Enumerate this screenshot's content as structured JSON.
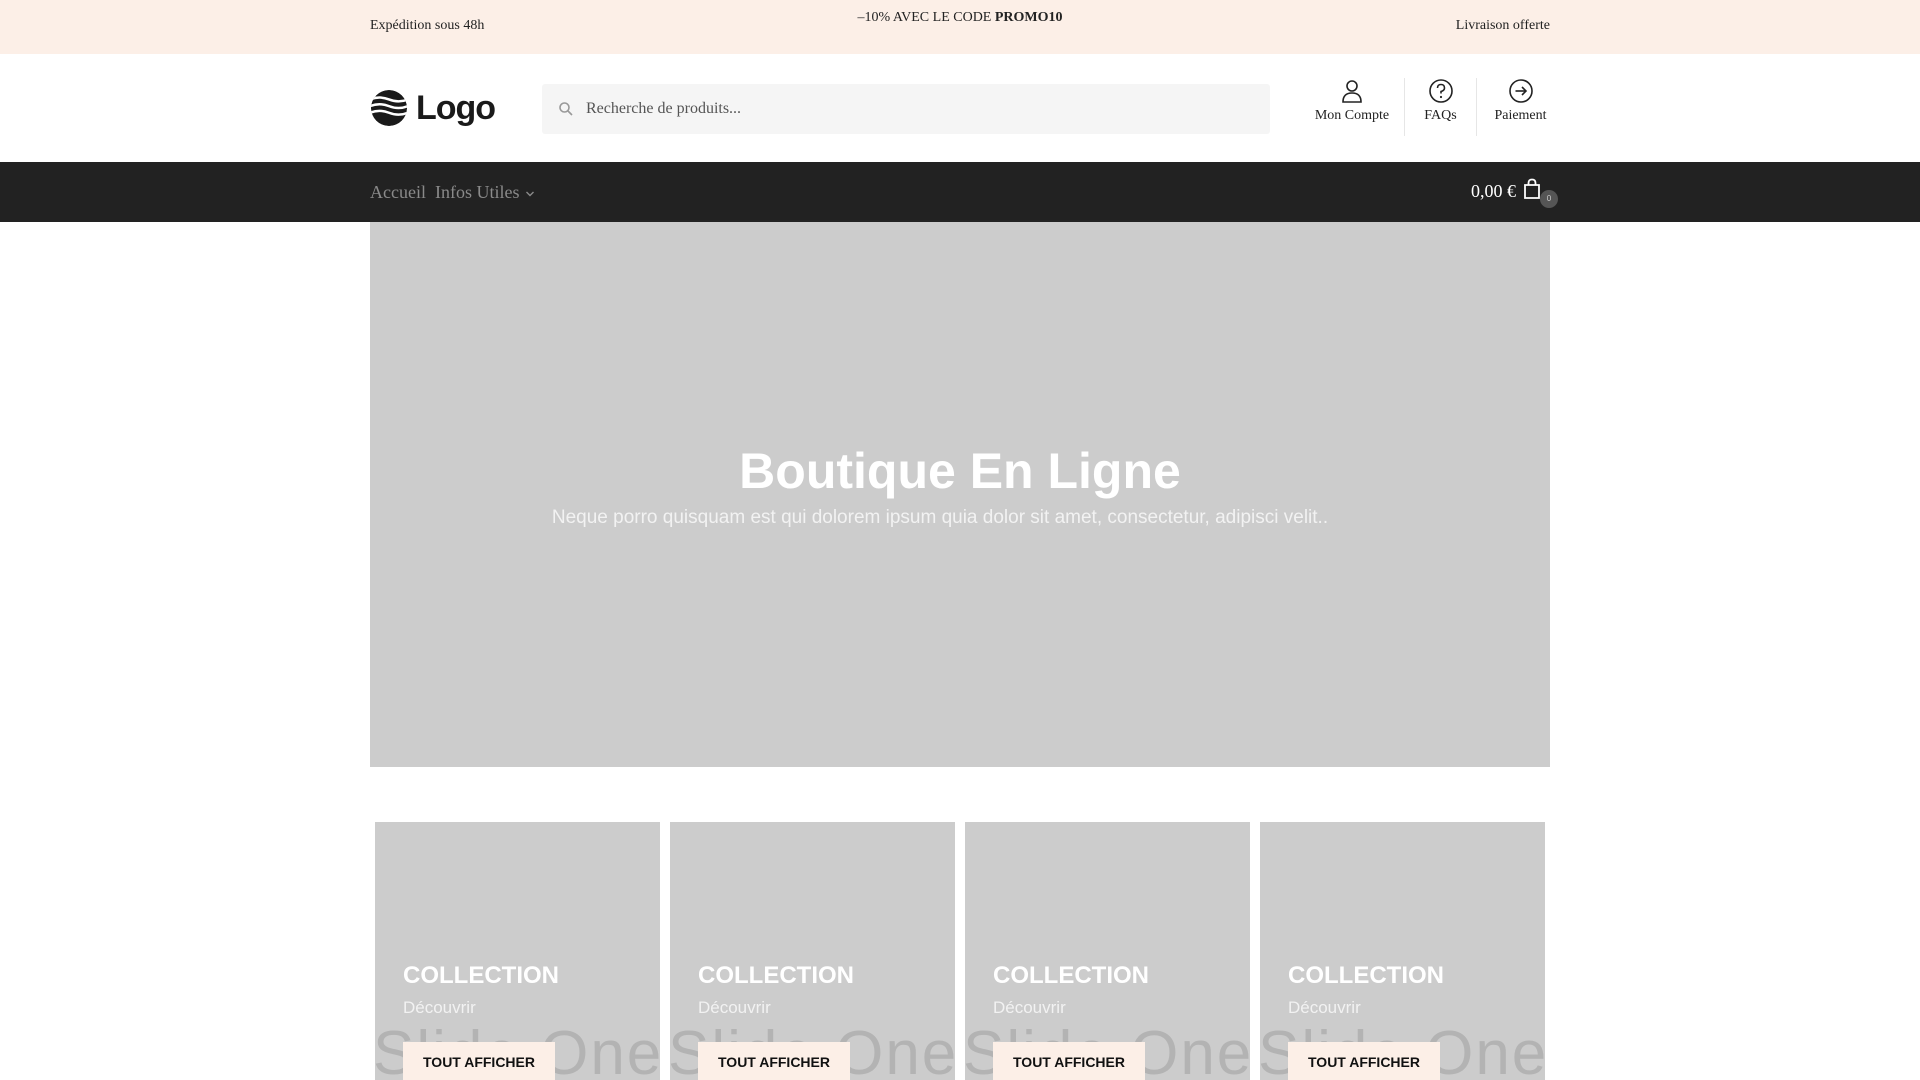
{
  "topbar": {
    "left_text": "Expédition sous 48h",
    "promo_prefix": "–10% AVEC LE CODE ",
    "promo_code": "PROMO10",
    "right_text": "Livraison offerte",
    "background": "#fcefe7"
  },
  "header": {
    "logo_text": "Logo",
    "search": {
      "placeholder": "Recherche de produits...",
      "value": "",
      "icon": "search-icon"
    },
    "links": [
      {
        "label": "Mon Compte",
        "icon": "user-icon"
      },
      {
        "label": "FAQs",
        "icon": "question-circle-icon"
      },
      {
        "label": "Paiement",
        "icon": "arrow-right-circle-icon"
      }
    ]
  },
  "nav": {
    "items": [
      {
        "label": "Accueil"
      },
      {
        "label": "Infos Utiles",
        "icon": "chevron-down-icon"
      }
    ],
    "cart": {
      "total": "0,00 €",
      "count": "0",
      "icon": "shopping-bag-icon"
    },
    "background": "#222222"
  },
  "hero": {
    "title": "Boutique En Ligne",
    "subtitle": "Neque porro quisquam est qui dolorem ipsum quia dolor sit amet, consectetur, adipisci velit.."
  },
  "collections": [
    {
      "title": "Collection",
      "subtitle": "Découvrir",
      "button": "TOUT AFFICHER",
      "watermark": "Slide One"
    },
    {
      "title": "Collection",
      "subtitle": "Découvrir",
      "button": "TOUT AFFICHER",
      "watermark": "Slide One"
    },
    {
      "title": "Collection",
      "subtitle": "Découvrir",
      "button": "TOUT AFFICHER",
      "watermark": "Slide One"
    },
    {
      "title": "Collection",
      "subtitle": "Découvrir",
      "button": "TOUT AFFICHER",
      "watermark": "Slide One"
    }
  ]
}
